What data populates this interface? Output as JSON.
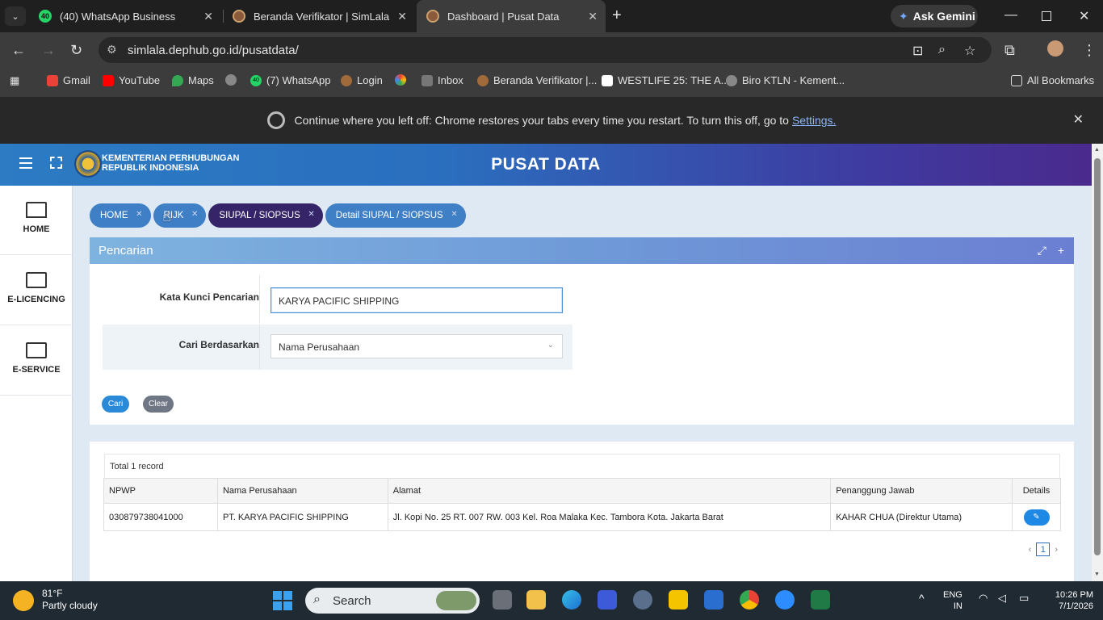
{
  "browser": {
    "tabs": [
      {
        "label": "(40) WhatsApp Business",
        "badge": "40"
      },
      {
        "label": "Beranda Verifikator | SimLala"
      },
      {
        "label": "Dashboard | Pusat Data"
      }
    ],
    "gemini_label": "Ask Gemini",
    "url": "simlala.dephub.go.id/pusatdata/",
    "bookmarks": [
      "Gmail",
      "YouTube",
      "Maps",
      "(7) WhatsApp",
      "Login",
      "Inbox",
      "Beranda Verifikator |...",
      "WESTLIFE 25: THE A...",
      "Biro KTLN - Kement..."
    ],
    "bookmark_badge": "40",
    "all_bookmarks": "All Bookmarks",
    "restore_text": "Continue where you left off: Chrome restores your tabs every time you restart. To turn this off, go to",
    "restore_link": "Settings."
  },
  "app": {
    "org_line1": "KEMENTERIAN PERHUBUNGAN",
    "org_line2": "REPUBLIK INDONESIA",
    "title": "PUSAT DATA",
    "sidebar": [
      {
        "label": "HOME",
        "icon": "monitor-icon"
      },
      {
        "label": "E-LICENCING",
        "icon": "list-card-icon"
      },
      {
        "label": "E-SERVICE",
        "icon": "list-card-icon"
      }
    ],
    "breadcrumbs": [
      "HOME",
      "RIJK",
      "SIUPAL / SIOPSUS",
      "Detail SIUPAL / SIOPSUS"
    ],
    "search_panel": {
      "title": "Pencarian",
      "keyword_label": "Kata Kunci Pencarian",
      "keyword_value": "KARYA PACIFIC SHIPPING",
      "search_by_label": "Cari Berdasarkan",
      "search_by_value": "Nama Perusahaan",
      "btn_search": "Cari",
      "btn_clear": "Clear"
    },
    "results": {
      "total": "Total 1 record",
      "columns": [
        "NPWP",
        "Nama Perusahaan",
        "Alamat",
        "Penanggung Jawab",
        "Details"
      ],
      "rows": [
        {
          "npwp": "030879738041000",
          "nama": "PT. KARYA PACIFIC SHIPPING",
          "alamat": "Jl. Kopi No. 25 RT. 007 RW. 003 Kel. Roa Malaka Kec. Tambora Kota. Jakarta Barat",
          "pj": "KAHAR CHUA (Direktur Utama)"
        }
      ],
      "page": "1"
    }
  },
  "taskbar": {
    "temp": "81°F",
    "weather": "Partly cloudy",
    "search_placeholder": "Search",
    "lang1": "ENG",
    "lang2": "IN",
    "time": "10:26 PM",
    "date": "7/1/2026"
  },
  "colors": {
    "header_start": "#2c7bc3",
    "header_end": "#4a2a8c",
    "crumb_blue": "#3f7fc6",
    "crumb_dark": "#352468",
    "primary_button": "#2a8ad8",
    "clear_button": "#6f7684"
  }
}
